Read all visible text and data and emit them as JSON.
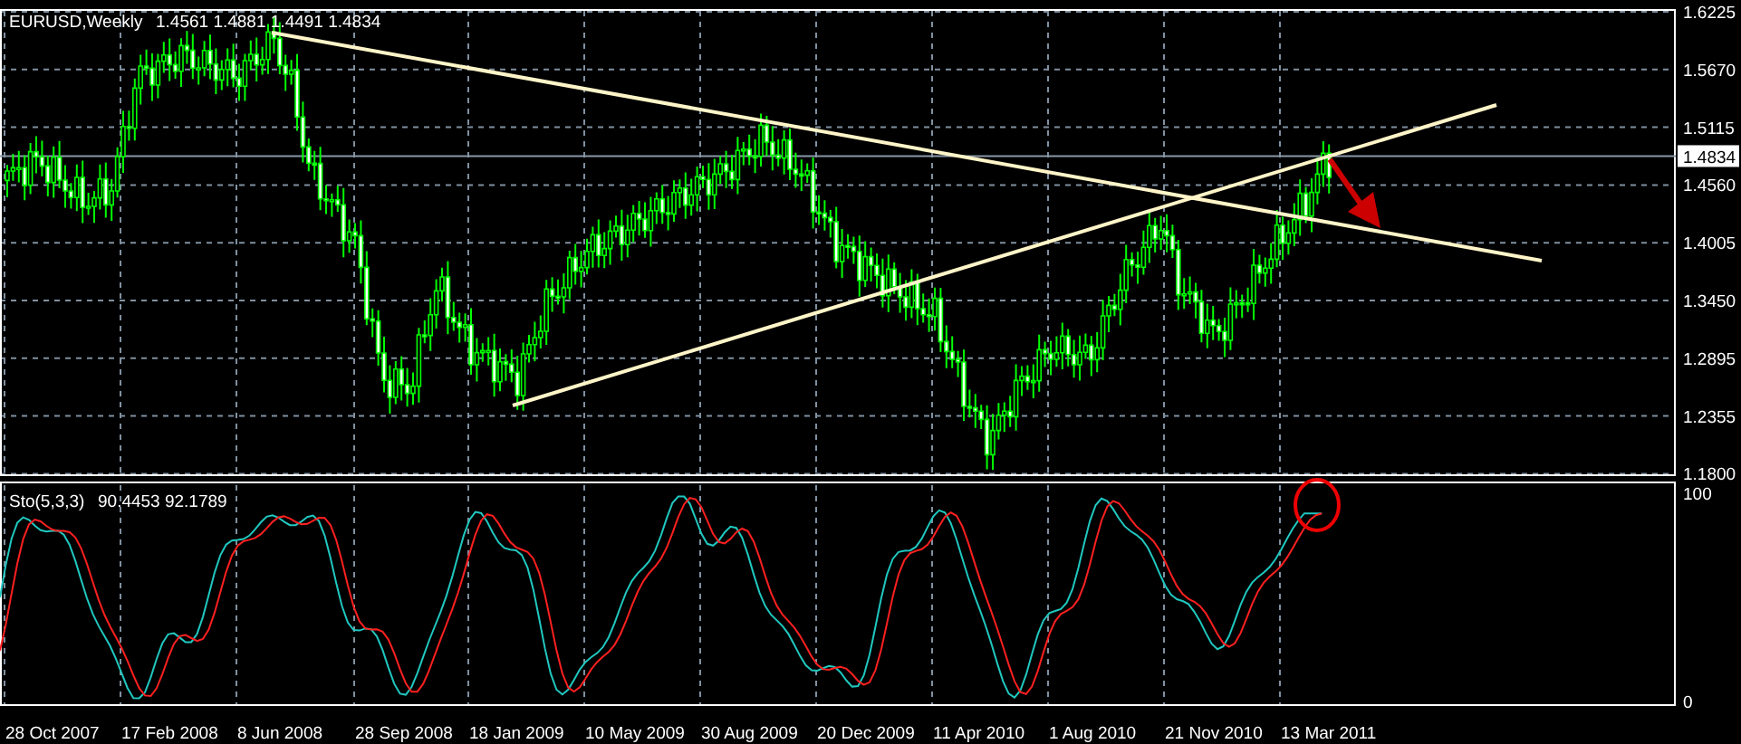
{
  "chart": {
    "title": "EURUSD,Weekly",
    "ohlc": "1.4561 1.4881 1.4491 1.4834",
    "price_axis": [
      "1.6225",
      "1.5670",
      "1.5115",
      "1.4560",
      "1.4005",
      "1.3450",
      "1.2895",
      "1.2355",
      "1.1800"
    ],
    "current_price": "1.4834",
    "dates": [
      "28 Oct 2007",
      "17 Feb 2008",
      "8 Jun 2008",
      "28 Sep 2008",
      "18 Jan 2009",
      "10 May 2009",
      "30 Aug 2009",
      "20 Dec 2009",
      "11 Apr 2010",
      "1 Aug 2010",
      "21 Nov 2010",
      "13 Mar 2011"
    ]
  },
  "indicator": {
    "title": "Sto(5,3,3)",
    "values": "90.4453 92.1789",
    "axis": [
      "100",
      "0"
    ]
  }
}
